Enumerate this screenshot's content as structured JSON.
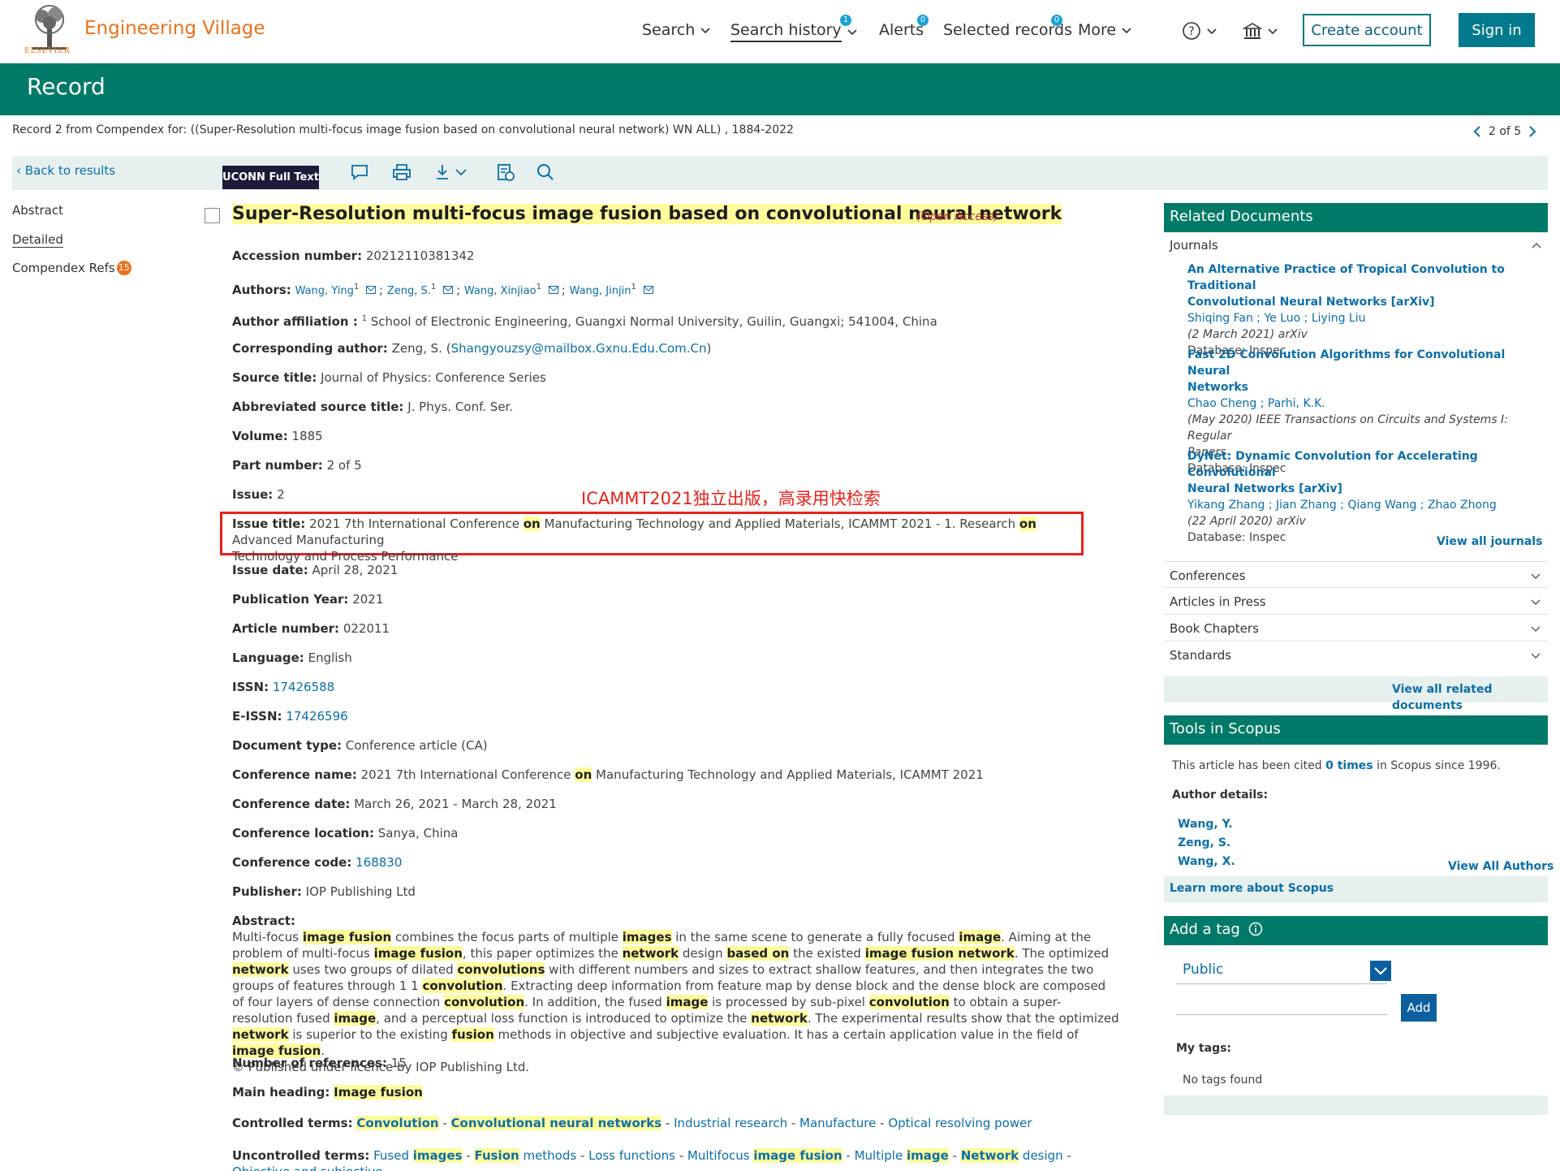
{
  "header": {
    "brand": "Engineering Village",
    "publisher_word": "ELSEVIER",
    "nav": {
      "search": "Search",
      "history": "Search history",
      "history_count": "1",
      "alerts": "Alerts",
      "alerts_count": "0",
      "selected": "Selected records",
      "selected_count": "0",
      "more": "More"
    },
    "create_account": "Create account",
    "sign_in": "Sign in"
  },
  "band": {
    "title": "Record"
  },
  "record": {
    "line": "Record 2 from Compendex for: ((Super-Resolution multi-focus image fusion based on convolutional   neural   network) WN ALL) , 1884-2022",
    "pager": "2 of 5"
  },
  "toolbar": {
    "back": "Back to results",
    "fulltext": "UCONN Full Text"
  },
  "rail": {
    "abstract": "Abstract",
    "detailed": "Detailed",
    "refs": "Compendex Refs",
    "refs_count": "15"
  },
  "doc": {
    "title": "Super-Resolution multi-focus image fusion based on convolutional neural network",
    "open_access": "Open Access",
    "accession_label": "Accession number:",
    "accession": "20212110381342",
    "authors_label": "Authors:",
    "authors": [
      "Wang, Ying",
      "Zeng, S.",
      "Wang, Xinjiao",
      "Wang, Jinjin"
    ],
    "author_sup": "1",
    "affiliation_label": "Author affiliation :",
    "affiliation": "School of Electronic Engineering, Guangxi Normal University, Guilin, Guangxi; 541004, China",
    "corresponding_label": "Corresponding author:",
    "corresponding": "Zeng, S.",
    "corresponding_email": "Shangyouzsy@mailbox.Gxnu.Edu.Com.Cn",
    "source_label": "Source title:",
    "source": "Journal of Physics: Conference Series",
    "abbr_label": "Abbreviated source title:",
    "abbr": "J. Phys. Conf. Ser.",
    "volume_label": "Volume:",
    "volume": "1885",
    "part_label": "Part number:",
    "part": "2 of 5",
    "issue_label": "Issue:",
    "issue": "2",
    "annotation": "ICAMMT2021独立出版，高录用快检索",
    "issue_title_label": "Issue title:",
    "issue_title_1": "2021 7th International Conference",
    "issue_title_on": "on",
    "issue_title_2": "Manufacturing Technology and Applied Materials, ICAMMT 2021 - 1. Research",
    "issue_title_3": "Advanced Manufacturing",
    "issue_title_4": "Technology and Process Performance",
    "issue_date_label": "Issue date:",
    "issue_date": "April 28, 2021",
    "pub_year_label": "Publication Year:",
    "pub_year": "2021",
    "article_label": "Article number:",
    "article": "022011",
    "language_label": "Language:",
    "language": "English",
    "issn_label": "ISSN:",
    "issn": "17426588",
    "eissn_label": "E-ISSN:",
    "eissn": "17426596",
    "doctype_label": "Document type:",
    "doctype": "Conference article (CA)",
    "conf_name_label": "Conference name:",
    "conf_name_1": "2021 7th International Conference",
    "conf_name_on": "on",
    "conf_name_2": "Manufacturing Technology and Applied Materials, ICAMMT 2021",
    "conf_date_label": "Conference date:",
    "conf_date": "March 26, 2021 - March 28, 2021",
    "conf_loc_label": "Conference location:",
    "conf_loc": "Sanya, China",
    "conf_code_label": "Conference code:",
    "conf_code": "168830",
    "publisher_label": "Publisher:",
    "publisher": "IOP Publishing Ltd",
    "abstract_label": "Abstract:",
    "abstract_parts": [
      {
        "t": "Multi-focus "
      },
      {
        "h": "image fusion"
      },
      {
        "t": " combines the focus parts of multiple "
      },
      {
        "h": "images"
      },
      {
        "t": " in the same scene to generate a fully focused "
      },
      {
        "h": "image"
      },
      {
        "t": ". Aiming at the problem of multi-focus "
      },
      {
        "h": "image fusion"
      },
      {
        "t": ", this paper optimizes the "
      },
      {
        "h": "network"
      },
      {
        "t": " design "
      },
      {
        "h": "based on"
      },
      {
        "t": " the existed "
      },
      {
        "h": "image fusion network"
      },
      {
        "t": ". The optimized "
      },
      {
        "h": "network"
      },
      {
        "t": " uses two groups of dilated "
      },
      {
        "h": "convolutions"
      },
      {
        "t": " with different numbers and sizes to extract shallow features, and then integrates the two groups of features through 1 1 "
      },
      {
        "h": "convolution"
      },
      {
        "t": ". Extracting deep information from feature map by dense block and the dense block are composed of four layers of dense connection "
      },
      {
        "h": "convolution"
      },
      {
        "t": ". In addition, the fused "
      },
      {
        "h": "image"
      },
      {
        "t": " is processed by sub-pixel "
      },
      {
        "h": "convolution"
      },
      {
        "t": " to obtain a super-resolution fused "
      },
      {
        "h": "image"
      },
      {
        "t": ", and a perceptual loss function is introduced to optimize the "
      },
      {
        "h": "network"
      },
      {
        "t": ". The experimental results show that the optimized "
      },
      {
        "h": "network"
      },
      {
        "t": " is superior to the existing "
      },
      {
        "h": "fusion"
      },
      {
        "t": " methods in objective and subjective evaluation. It has a certain application value in the field of "
      },
      {
        "h": "image fusion"
      },
      {
        "t": "."
      }
    ],
    "copyright": "© Published under licence by IOP Publishing Ltd.",
    "num_refs_label": "Number of references:",
    "num_refs": "15",
    "main_heading_label": "Main heading:",
    "main_heading": "Image fusion",
    "controlled_label": "Controlled terms:",
    "controlled": [
      {
        "h": "Convolution"
      },
      {
        "h": "Convolutional neural networks"
      },
      {
        "t": "Industrial research"
      },
      {
        "t": "Manufacture"
      },
      {
        "t": "Optical resolving power"
      }
    ],
    "uncontrolled_label": "Uncontrolled terms:",
    "uncontrolled": [
      [
        {
          "t": "Fused "
        },
        {
          "h": "images"
        }
      ],
      [
        {
          "h": "Fusion"
        },
        {
          "t": " methods"
        }
      ],
      [
        {
          "t": "Loss functions"
        }
      ],
      [
        {
          "t": "Multifocus "
        },
        {
          "h": "image fusion"
        }
      ],
      [
        {
          "t": "Multiple "
        },
        {
          "h": "image"
        }
      ],
      [
        {
          "h": "Network"
        },
        {
          "t": " design"
        }
      ],
      [
        {
          "t": "Objective and subjective"
        }
      ]
    ]
  },
  "related": {
    "head": "Related Documents",
    "journals_label": "Journals",
    "journals": [
      {
        "title_1": "An Alternative Practice of Tropical Convolution to Traditional",
        "title_2": "Convolutional Neural Networks [arXiv]",
        "authors": "Shiqing Fan ; Ye Luo ; Liying Liu",
        "meta_1": "(2 March 2021) arXiv",
        "db": "Database: Inspec"
      },
      {
        "title_1": "Fast 2D Convolution Algorithms for Convolutional Neural",
        "title_2": "Networks",
        "authors": "Chao Cheng ; Parhi, K.K.",
        "meta_1": "(May 2020) IEEE Transactions on Circuits and Systems I: Regular",
        "meta_2": "Papers",
        "db": "Database: Inspec"
      },
      {
        "title_1": "DyNet: Dynamic Convolution for Accelerating Convolutional",
        "title_2": "Neural Networks [arXiv]",
        "authors": "Yikang Zhang ; Jian Zhang ; Qiang Wang ; Zhao Zhong",
        "meta_1": "(22 April 2020) arXiv",
        "db": "Database: Inspec"
      }
    ],
    "view_journals": "View all journals",
    "sections": [
      "Conferences",
      "Articles in Press",
      "Book Chapters",
      "Standards"
    ],
    "view_all": "View all related documents"
  },
  "scopus": {
    "head": "Tools in Scopus",
    "cited_1": "This article has been cited",
    "cited_link": "0 times",
    "cited_2": "in Scopus since 1996.",
    "author_details": "Author details:",
    "authors": [
      "Wang, Y.",
      "Zeng, S.",
      "Wang, X."
    ],
    "view_all_authors": "View All Authors",
    "learn_more": "Learn more about Scopus"
  },
  "tag": {
    "head": "Add a tag",
    "select_value": "Public",
    "add": "Add",
    "my_tags": "My tags:",
    "no_tags": "No tags found"
  },
  "colors": {
    "brand_orange": "#e9711c",
    "band_green": "#007a68",
    "link_blue": "#0c6ea8",
    "highlight": "#fffb9c",
    "annotation_red": "#e8211c"
  }
}
